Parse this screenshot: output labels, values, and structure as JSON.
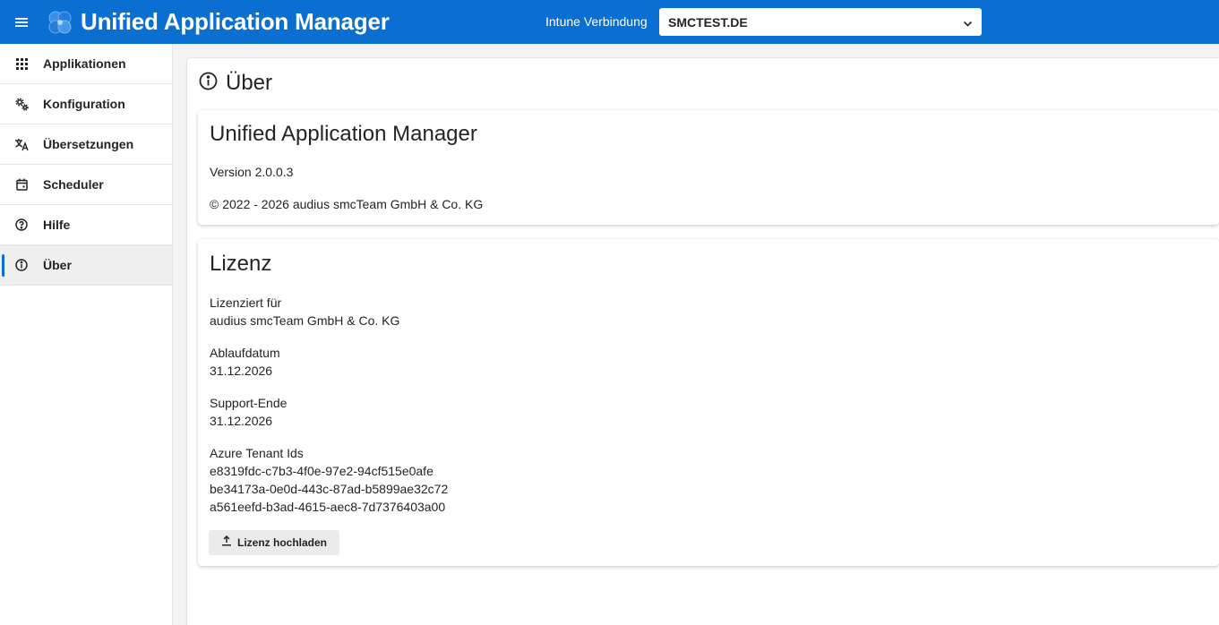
{
  "app": {
    "title": "Unified Application Manager",
    "accent_color": "#0a6fd0",
    "menu_icon": "hamburger-menu-icon",
    "logo_icon": "app-logo-icon"
  },
  "connection": {
    "label": "Intune Verbindung",
    "selected_tenant": "SMCTEST.DE",
    "chevron_icon": "chevron-down-icon"
  },
  "sidebar": {
    "items": [
      {
        "label": "Applikationen",
        "icon": "apps-grid-icon",
        "active": false
      },
      {
        "label": "Konfiguration",
        "icon": "gears-icon",
        "active": false
      },
      {
        "label": "Übersetzungen",
        "icon": "translate-icon",
        "active": false
      },
      {
        "label": "Scheduler",
        "icon": "calendar-icon",
        "active": false
      },
      {
        "label": "Hilfe",
        "icon": "help-icon",
        "active": false
      },
      {
        "label": "Über",
        "icon": "info-icon",
        "active": true
      }
    ]
  },
  "page": {
    "title": "Über",
    "icon": "info-icon"
  },
  "about_card": {
    "title": "Unified Application Manager",
    "version": "Version 2.0.0.3",
    "copyright": "© 2022 - 2026 audius smcTeam GmbH & Co. KG"
  },
  "license_card": {
    "title": "Lizenz",
    "licensed_for_label": "Lizenziert für",
    "licensed_for_value": "audius smcTeam GmbH & Co. KG",
    "expiry_label": "Ablaufdatum",
    "expiry_value": "31.12.2026",
    "support_end_label": "Support-Ende",
    "support_end_value": "31.12.2026",
    "tenant_ids_label": "Azure Tenant Ids",
    "tenant_ids": [
      "e8319fdc-c7b3-4f0e-97e2-94cf515e0afe",
      "be34173a-0e0d-443c-87ad-b5899ae32c72",
      "a561eefd-b3ad-4615-aec8-7d7376403a00"
    ],
    "upload_button_label": "Lizenz hochladen",
    "upload_icon": "upload-icon"
  }
}
